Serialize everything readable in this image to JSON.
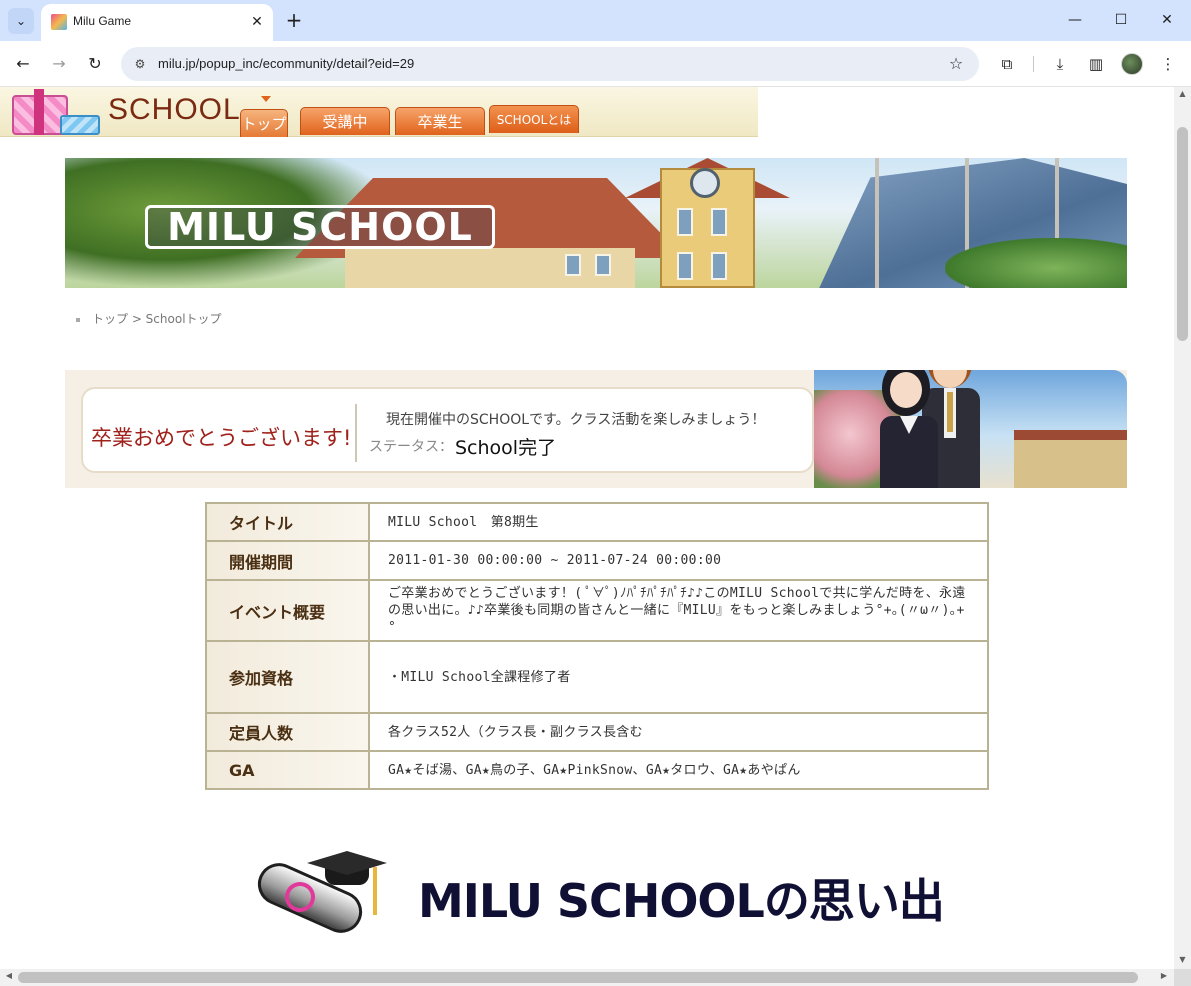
{
  "browser": {
    "tab_title": "Milu Game",
    "url": "milu.jp/popup_inc/ecommunity/detail?eid=29"
  },
  "site": {
    "logo_text": "SCHOOL",
    "nav": [
      "トップ",
      "受講中",
      "卒業生",
      "SCHOOLとは"
    ],
    "banner_title": "MILU SCHOOL"
  },
  "breadcrumb": "トップ > Schoolトップ",
  "status": {
    "congrats": "卒業おめでとうございます!",
    "message": "現在開催中のSCHOOLです。クラス活動を楽しみましょう！",
    "label": "ステータス：",
    "value": "School完了"
  },
  "details": [
    {
      "label": "タイトル",
      "value": "MILU School　第8期生"
    },
    {
      "label": "開催期間",
      "value": "2011-01-30 00:00:00 ~ 2011-07-24 00:00:00"
    },
    {
      "label": "イベント概要",
      "value": "ご卒業おめでとうございます！( ﾟ∀ﾟ)ﾉﾊﾟﾁﾊﾟﾁﾊﾟﾁ♪♪このMILU Schoolで共に学んだ時を、永遠の思い出に。♪♪卒業後も同期の皆さんと一緒に『MILU』をもっと楽しみましょう°+｡(〃ω〃)｡+°"
    },
    {
      "label": "参加資格",
      "value": "・MILU School全課程修了者"
    },
    {
      "label": "定員人数",
      "value": "各クラス52人（クラス長・副クラス長含む"
    },
    {
      "label": "GA",
      "value": "GA★そば湯、GA★鳥の子、GA★PinkSnow、GA★タロウ、GA★あやぱん"
    }
  ],
  "memories_title": "MILU SCHOOLの思い出",
  "colors": {
    "nav_tab": "#e0631c",
    "congrats_text": "#a0201a",
    "table_border": "#b9b293",
    "memories_title": "#101035",
    "chrome_tabstrip": "#d3e3fd"
  },
  "icons": {
    "tab_switch": "chevron-down-icon",
    "new_tab": "plus-icon",
    "back": "arrow-left-icon",
    "forward": "arrow-right-icon",
    "reload": "reload-icon",
    "site_info": "tune-icon",
    "bookmark": "star-icon",
    "extensions": "puzzle-icon",
    "downloads": "download-icon",
    "side_panel": "side-panel-icon",
    "menu": "kebab-menu-icon"
  }
}
